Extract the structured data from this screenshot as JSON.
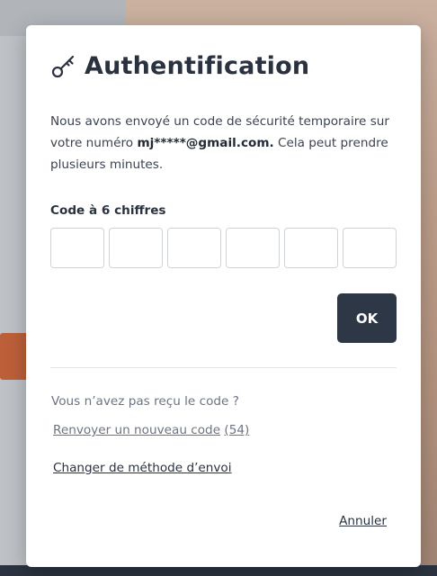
{
  "modal": {
    "title": "Authentification",
    "description_prefix": "Nous avons envoyé un code de sécurité temporaire sur votre numéro",
    "description_identifier": "mj*****@gmail.com.",
    "description_suffix": "Cela peut prendre plusieurs minutes.",
    "code_label": "Code à 6 chiffres",
    "code_digits": [
      "",
      "",
      "",
      "",
      "",
      ""
    ],
    "ok_label": "OK",
    "not_received_text": "Vous n’avez pas reçu le code ?",
    "resend_label": "Renvoyer un nouveau code",
    "resend_countdown": "(54)",
    "change_method_label": "Changer de méthode d’envoi",
    "cancel_label": "Annuler"
  },
  "icons": {
    "title_icon": "key-icon"
  },
  "colors": {
    "primary_button": "#2d3746",
    "title_text": "#2a3240",
    "muted_text": "#6a7484"
  }
}
